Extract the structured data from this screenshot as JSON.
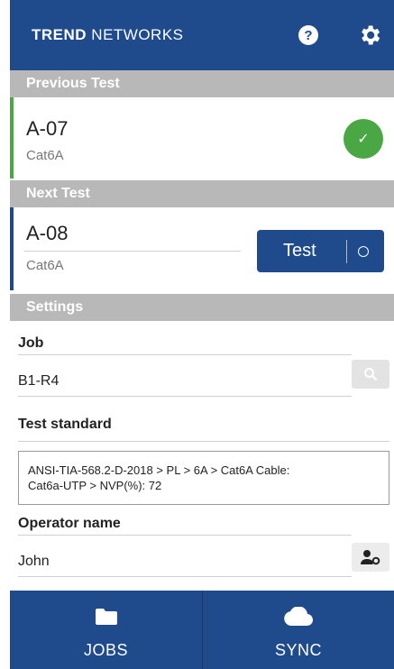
{
  "header": {
    "brand_bold": "TREND",
    "brand_rest": " NETWORKS",
    "help_icon": "?"
  },
  "previous_test": {
    "section_label": "Previous Test",
    "code": "A-07",
    "cable": "Cat6A",
    "status": "passed",
    "status_color": "#4aa844",
    "check_glyph": "✓"
  },
  "next_test": {
    "section_label": "Next Test",
    "code": "A-08",
    "cable": "Cat6A",
    "test_button_label": "Test"
  },
  "settings": {
    "section_label": "Settings",
    "job": {
      "label": "Job",
      "value": "B1-R4"
    },
    "test_standard": {
      "label": "Test standard",
      "line1": "ANSI-TIA-568.2-D-2018 > PL > 6A > Cat6A Cable:",
      "line2": "Cat6a-UTP > NVP(%): 72"
    },
    "operator": {
      "label": "Operator name",
      "value": "John"
    }
  },
  "footer": {
    "jobs_label": "JOBS",
    "sync_label": "SYNC"
  },
  "colors": {
    "primary": "#1f4a8c",
    "section_bar": "#b8b8b8",
    "prev_stripe": "#4aa844",
    "next_stripe": "#1f4a8c"
  }
}
